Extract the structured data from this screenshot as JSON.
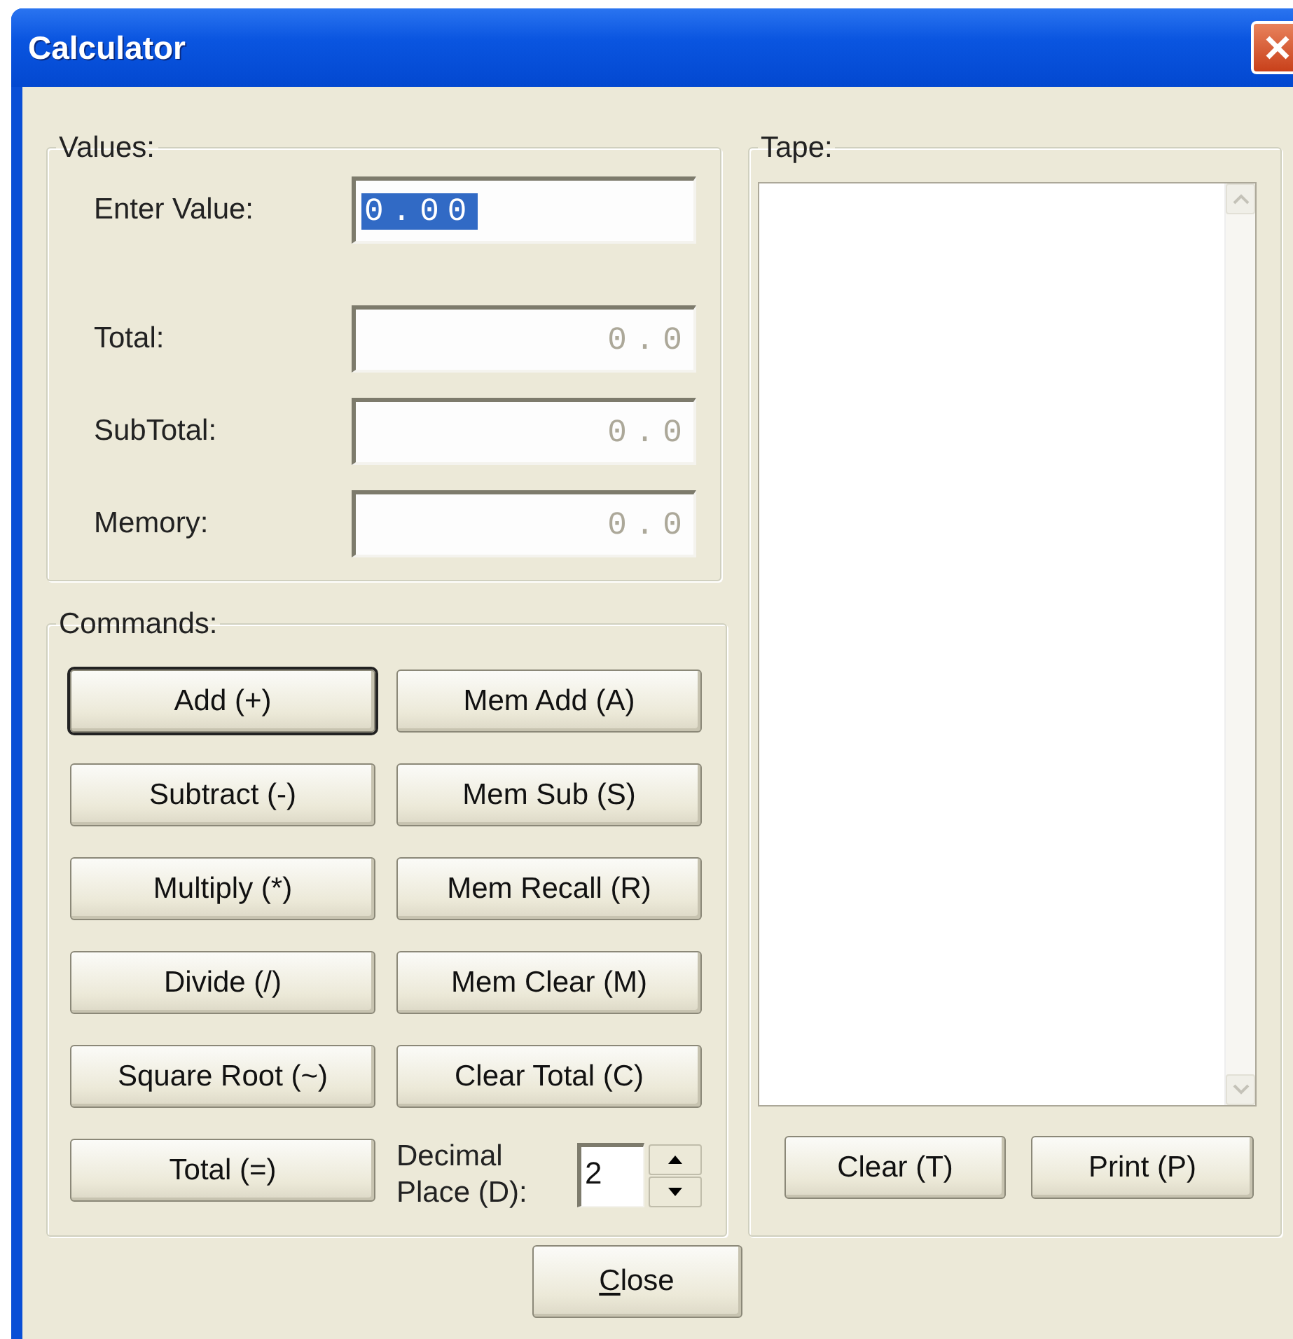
{
  "window": {
    "title": "Calculator"
  },
  "values": {
    "legend": "Values:",
    "fields": [
      {
        "label": "Enter Value:",
        "value": "0.00",
        "selected": true,
        "disabled": false
      },
      {
        "label": "Total:",
        "value": "0.0",
        "selected": false,
        "disabled": true
      },
      {
        "label": "SubTotal:",
        "value": "0.0",
        "selected": false,
        "disabled": true
      },
      {
        "label": "Memory:",
        "value": "0.0",
        "selected": false,
        "disabled": true
      }
    ]
  },
  "commands": {
    "legend": "Commands:",
    "items": [
      {
        "kind": "button",
        "label": "Add (+)",
        "default": true
      },
      {
        "kind": "button",
        "label": "Mem Add (A)",
        "default": false
      },
      {
        "kind": "button",
        "label": "Subtract (-)",
        "default": false
      },
      {
        "kind": "button",
        "label": "Mem Sub (S)",
        "default": false
      },
      {
        "kind": "button",
        "label": "Multiply (*)",
        "default": false
      },
      {
        "kind": "button",
        "label": "Mem Recall (R)",
        "default": false
      },
      {
        "kind": "button",
        "label": "Divide (/)",
        "default": false
      },
      {
        "kind": "button",
        "label": "Mem Clear (M)",
        "default": false
      },
      {
        "kind": "button",
        "label": "Square Root (~)",
        "default": false
      },
      {
        "kind": "button",
        "label": "Clear Total (C)",
        "default": false
      },
      {
        "kind": "button",
        "label": "Total (=)",
        "default": false
      },
      {
        "kind": "spinner",
        "label": "Decimal Place (D):",
        "value": "2"
      }
    ]
  },
  "tape": {
    "legend": "Tape:",
    "buttons": [
      "Clear (T)",
      "Print (P)"
    ]
  },
  "close_button": {
    "label": "Close",
    "first_letter_underlined": true
  }
}
